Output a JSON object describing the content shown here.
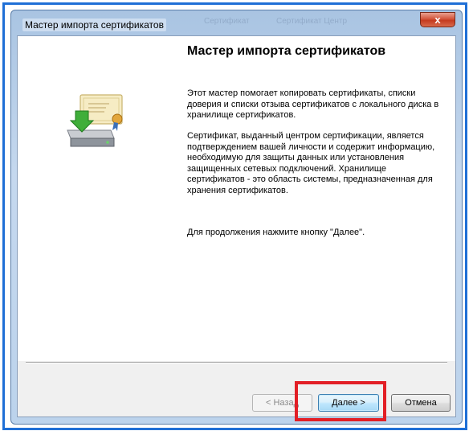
{
  "window": {
    "title": "Мастер импорта сертификатов",
    "close_glyph": "x",
    "ghost_a": "Сертификат",
    "ghost_b": "Сертификат Центр"
  },
  "content": {
    "heading": "Мастер импорта сертификатов",
    "paragraphs": [
      "Этот мастер помогает копировать сертификаты, списки доверия и списки отзыва сертификатов с локального диска в хранилище сертификатов.",
      "Сертификат, выданный центром сертификации, является подтверждением вашей личности и содержит информацию, необходимую для защиты данных или установления защищенных сетевых подключений. Хранилище сертификатов - это область системы, предназначенная для хранения сертификатов.",
      "Для продолжения нажмите кнопку \"Далее\"."
    ]
  },
  "buttons": {
    "back": "< Назад",
    "next": "Далее >",
    "cancel": "Отмена"
  },
  "colors": {
    "frame": "#1f6fd6",
    "highlight": "#e21f26"
  },
  "icons": {
    "wizard": "certificate-install-icon"
  }
}
